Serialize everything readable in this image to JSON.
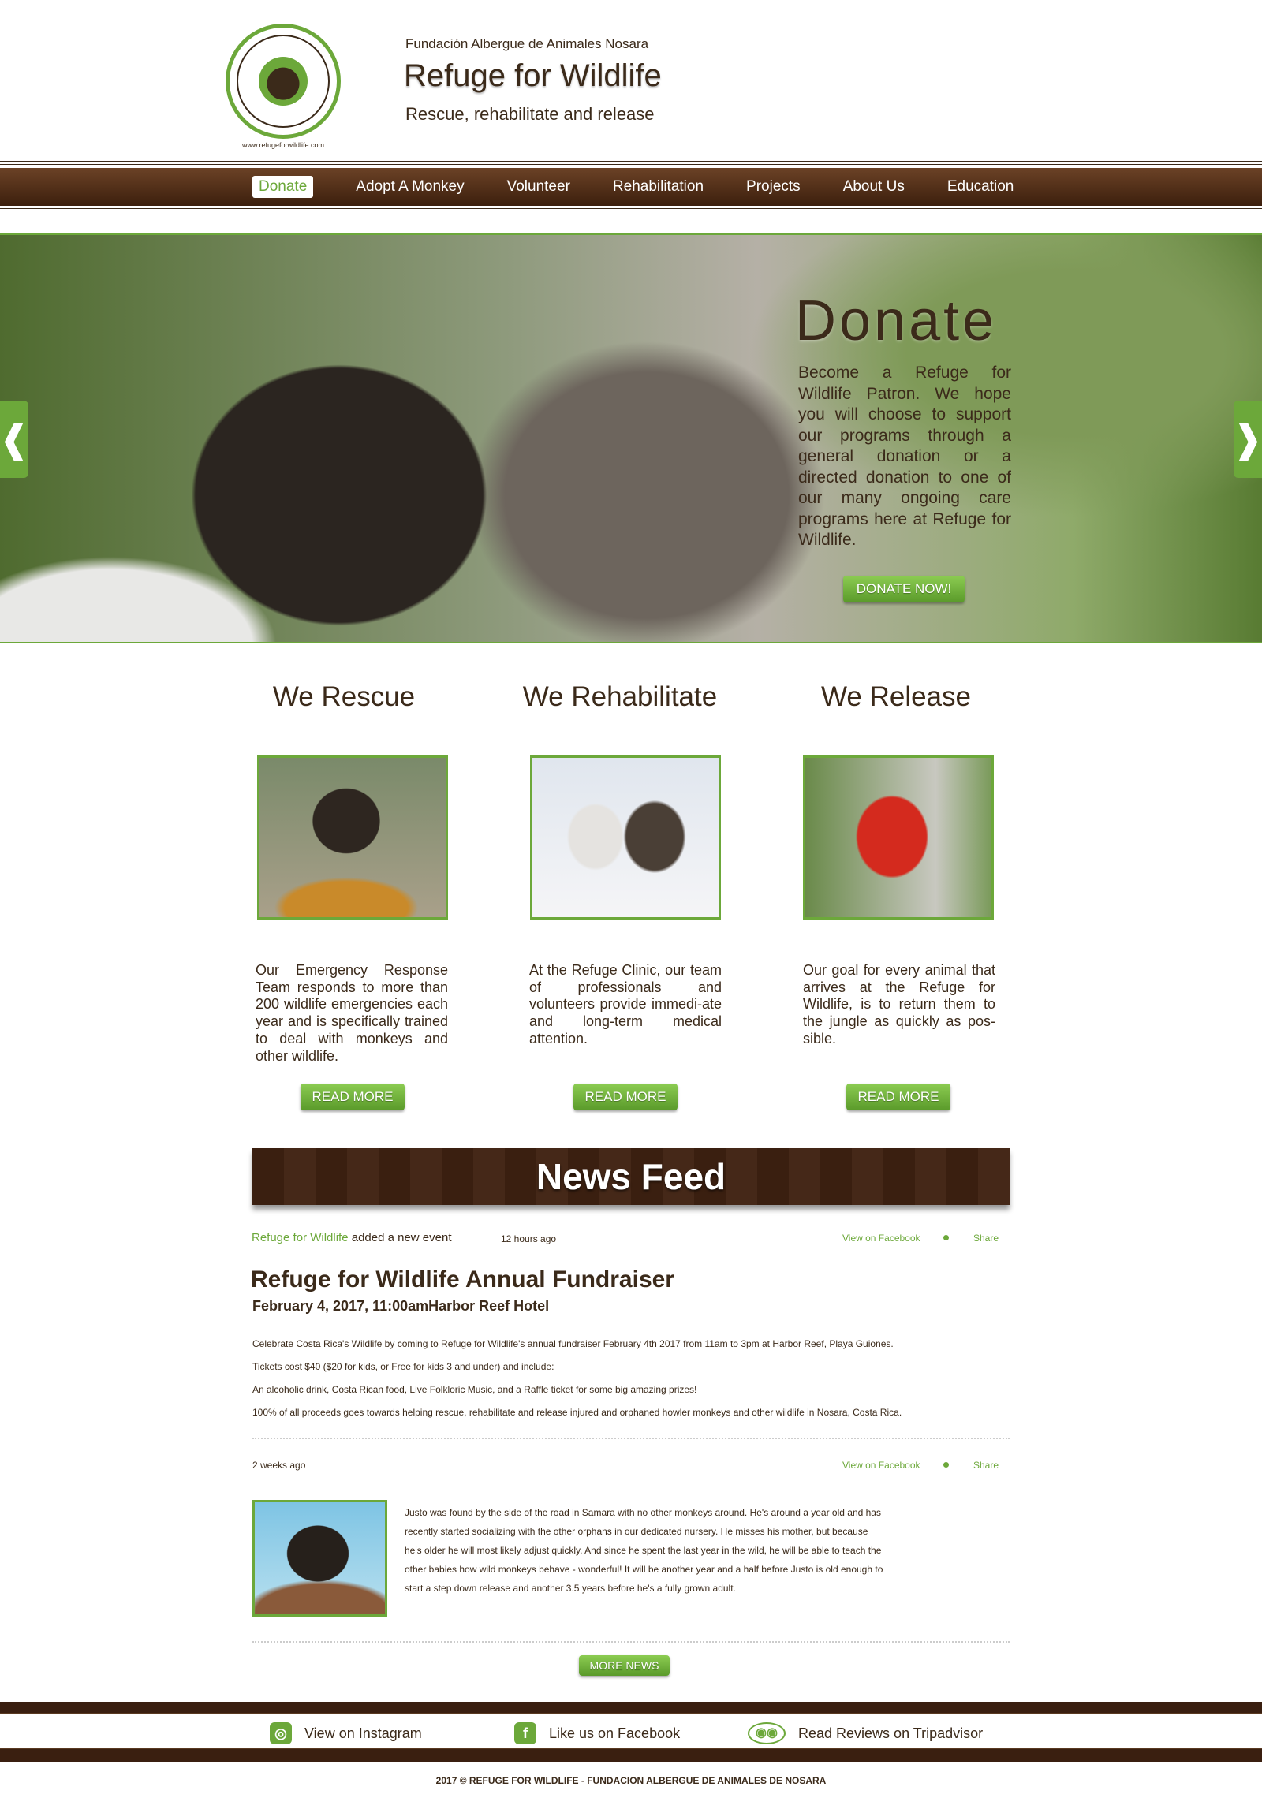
{
  "header": {
    "org": "Fundación Albergue de Animales Nosara",
    "title": "Refuge for Wildlife",
    "tagline": "Rescue, rehabilitate and release",
    "logo_url": "www.refugeforwildlife.com"
  },
  "nav": [
    "Donate",
    "Adopt A Monkey",
    "Volunteer",
    "Rehabilitation",
    "Projects",
    "About Us",
    "Education"
  ],
  "hero": {
    "title": "Donate",
    "text": "Become a Refuge for Wildlife Patron. We hope you will choose to support our programs through a general donation or a directed donation to one of our many ongoing care programs here at Refuge for Wildlife.",
    "button": "DONATE NOW!",
    "prev": "❰",
    "next": "❱"
  },
  "columns": [
    {
      "heading": "We Rescue",
      "text": "Our Emergency Response Team responds to more than 200 wildlife emergencies each year and is specifically trained to deal with monkeys and other wildlife.",
      "button": "READ MORE"
    },
    {
      "heading": "We Rehabilitate",
      "text": "At the Refuge Clinic, our team of professionals and volunteers provide immedi-ate and long-term medical attention.",
      "button": "READ MORE"
    },
    {
      "heading": "We Release",
      "text": "Our goal for every animal that arrives at the Refuge for Wildlife, is to return them to the jungle as quickly as pos-sible.",
      "button": "READ MORE"
    }
  ],
  "news": {
    "heading": "News Feed",
    "post1": {
      "author": "Refuge for Wildlife",
      "action": "added a new event",
      "time": "12 hours ago",
      "view": "View on Facebook",
      "share": "Share",
      "title": "Refuge for Wildlife Annual Fundraiser",
      "date": "February 4, 2017,   11:00amHarbor Reef Hotel",
      "lines": [
        "Celebrate Costa Rica's Wildlife by coming to Refuge for Wildlife's annual fundraiser February 4th 2017 from 11am to 3pm at Harbor Reef, Playa Guiones.",
        "Tickets cost $40 ($20 for kids, or Free for kids 3 and under) and include:",
        "An alcoholic drink, Costa Rican food, Live Folkloric Music, and a Raffle ticket for some big amazing prizes!",
        "100% of all proceeds goes towards helping rescue, rehabilitate and release injured and orphaned howler monkeys and other wildlife in Nosara, Costa Rica."
      ]
    },
    "post2": {
      "time": "2 weeks ago",
      "view": "View on Facebook",
      "share": "Share",
      "text": "Justo was found by the side of the road in Samara with no other monkeys around. He's around a year old and has recently started socializing with the other orphans in our dedicated nursery. He misses his mother, but because he's older he will most likely adjust quickly. And since he spent the last year in the wild, he will be able to teach the other babies how wild monkeys behave - wonderful! It will be another year and a half before Justo is old enough to start a step down release and another 3.5 years before he's a fully grown adult."
    },
    "more": "MORE NEWS"
  },
  "footer": {
    "instagram": "View on Instagram",
    "facebook": "Like us on Facebook",
    "tripadvisor": "Read Reviews on Tripadvisor",
    "copyright": "2017   ©   REFUGE FOR WILDLIFE - FUNDACION ALBERGUE DE ANIMALES DE NOSARA"
  },
  "colors": {
    "accent": "#6ca83a",
    "brown": "#3b2a1a"
  }
}
